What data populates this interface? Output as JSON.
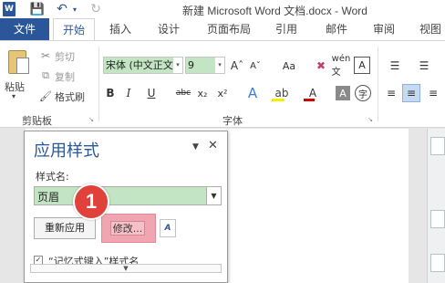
{
  "title_bar": {
    "app_icon": "W",
    "save_icon": "save-icon",
    "undo_icon": "undo-icon",
    "redo_icon": "redo-icon",
    "title": "新建 Microsoft Word 文档.docx - Word"
  },
  "tabs": [
    {
      "label": "文件"
    },
    {
      "label": "开始"
    },
    {
      "label": "插入"
    },
    {
      "label": "设计"
    },
    {
      "label": "页面布局"
    },
    {
      "label": "引用"
    },
    {
      "label": "邮件"
    },
    {
      "label": "审阅"
    },
    {
      "label": "视图"
    }
  ],
  "ribbon": {
    "clipboard": {
      "paste_label": "粘贴",
      "cut_label": "剪切",
      "copy_label": "复制",
      "painter_label": "格式刷",
      "group_label": "剪贴板"
    },
    "font": {
      "font_name": "宋体 (中文正文",
      "font_size": "9",
      "grow": "Aˆ",
      "shrink": "Aˇ",
      "change_case": "Aa",
      "phonetic": "wén文",
      "char_border": "A",
      "bold": "B",
      "italic": "I",
      "underline": "U",
      "strike": "abc",
      "subscript": "x₂",
      "superscript": "x²",
      "text_effects": "A",
      "highlight": "ab",
      "font_color": "A",
      "char_shading": "A",
      "enclose": "字",
      "group_label": "字体"
    },
    "paragraph": {
      "bullets": "☰",
      "numbering": "☰",
      "align_left": "≡",
      "align_center": "≡",
      "align_right": "≡"
    }
  },
  "pane": {
    "title": "应用样式",
    "style_name_label": "样式名:",
    "style_name_value": "页眉",
    "reapply_label": "重新应用",
    "modify_label": "修改...",
    "styles_label": "A",
    "autocomplete_label": "“记忆式键入”样式名",
    "autocomplete_checked": true
  },
  "annotation": {
    "step_number": "1",
    "color": "#e0413a"
  },
  "colors": {
    "word_blue": "#2b579a",
    "selection_green": "#c3e5c3",
    "highlight_pink": "#f0a5b0"
  }
}
